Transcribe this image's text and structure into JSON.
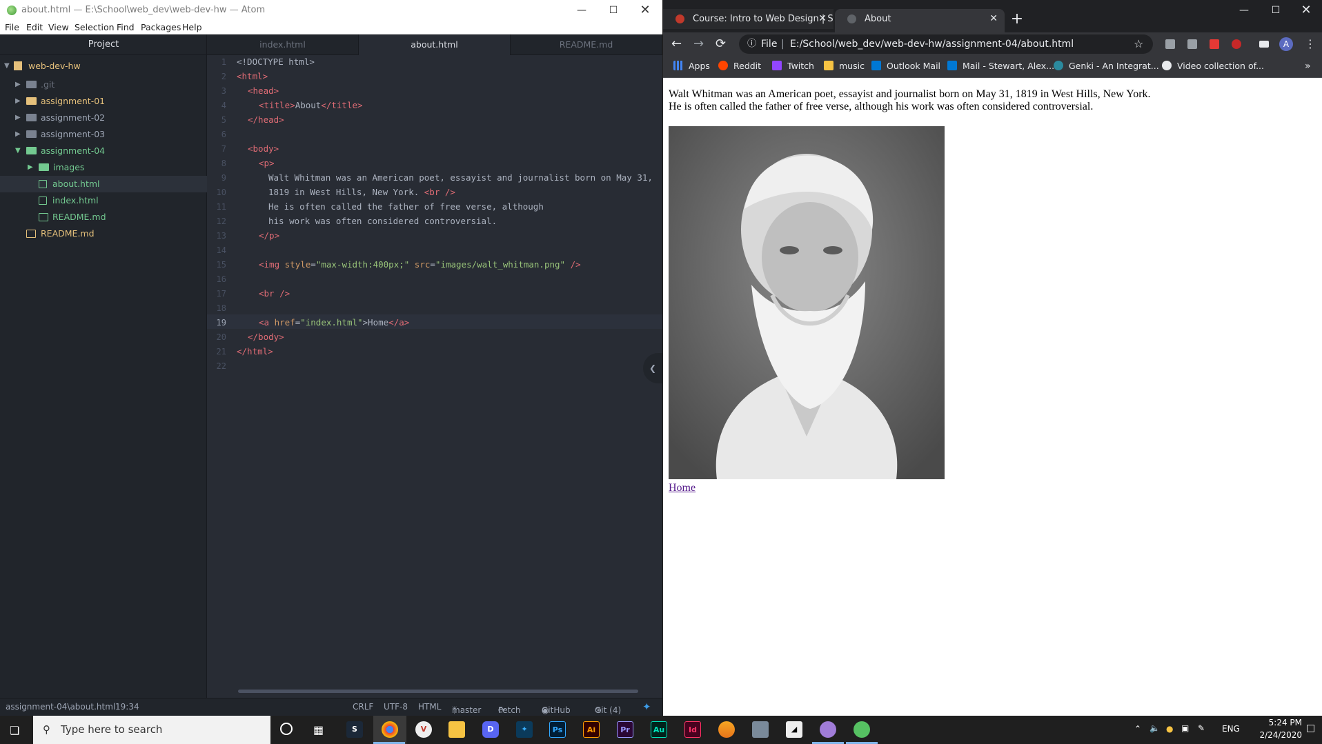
{
  "atom": {
    "title": "about.html — E:\\School\\web_dev\\web-dev-hw — Atom",
    "menu": [
      "File",
      "Edit",
      "View",
      "Selection",
      "Find",
      "Packages",
      "Help"
    ],
    "tree_header": "Project",
    "tree": [
      {
        "label": "web-dev-hw"
      },
      {
        "label": ".git"
      },
      {
        "label": "assignment-01"
      },
      {
        "label": "assignment-02"
      },
      {
        "label": "assignment-03"
      },
      {
        "label": "assignment-04"
      },
      {
        "label": "images"
      },
      {
        "label": "about.html"
      },
      {
        "label": "index.html"
      },
      {
        "label": "README.md"
      },
      {
        "label": "README.md"
      }
    ],
    "tabs": [
      "index.html",
      "about.html",
      "README.md"
    ],
    "gutter": [
      "1",
      "2",
      "3",
      "4",
      "5",
      "6",
      "7",
      "8",
      "9",
      "10",
      "11",
      "12",
      "13",
      "14",
      "15",
      "16",
      "17",
      "18",
      "19",
      "20",
      "21",
      "22"
    ],
    "status": {
      "path": "assignment-04\\about.html",
      "cursor": "19:34",
      "line_ending": "CRLF",
      "encoding": "UTF-8",
      "grammar": "HTML",
      "branch": "master",
      "fetch": "Fetch",
      "github": "GitHub",
      "git": "Git (4)"
    },
    "code": {
      "l1": "<!DOCTYPE html>",
      "l2": "<html>",
      "l3": "<head>",
      "l4a": "<title>",
      "l4b": "About",
      "l4c": "</title>",
      "l5": "</head>",
      "l7": "<body>",
      "l8": "<p>",
      "l9": "Walt Whitman was an American poet, essayist and journalist born on May 31,",
      "l10a": "1819 in West Hills, New York. ",
      "l10b": "<br />",
      "l11": "He is often called the father of free verse, although",
      "l12": "his work was often considered controversial.",
      "l13": "</p>",
      "l15a": "<img ",
      "l15b": "style",
      "l15c": "=",
      "l15d": "\"max-width:400px;\"",
      "l15e": " src",
      "l15f": "=",
      "l15g": "\"images/walt_whitman.png\"",
      "l15h": " />",
      "l17": "<br />",
      "l19a": "<a ",
      "l19b": "href",
      "l19c": "=",
      "l19d": "\"index.html\"",
      "l19e": ">Home",
      "l19f": "</a>",
      "l20": "</body>",
      "l21": "</html>"
    }
  },
  "chrome": {
    "tabs": [
      {
        "title": "Course: Intro to Web Design | Sp"
      },
      {
        "title": "About"
      }
    ],
    "address_prefix": "File",
    "url": "E:/School/web_dev/web-dev-hw/assignment-04/about.html",
    "profile_initial": "A",
    "bookmarks": [
      "Apps",
      "Reddit",
      "Twitch",
      "music",
      "Outlook Mail",
      "Mail - Stewart, Alex...",
      "Genki - An Integrat...",
      "Video collection of..."
    ],
    "page": {
      "line1": "Walt Whitman was an American poet, essayist and journalist born on May 31, 1819 in West Hills, New York.",
      "line2": "He is often called the father of free verse, although his work was often considered controversial.",
      "link": "Home"
    }
  },
  "taskbar": {
    "search_placeholder": "Type here to search",
    "apps": [
      "Ps",
      "Ai",
      "Pr",
      "Au",
      "Id"
    ],
    "lang": "ENG",
    "time": "5:24 PM",
    "date": "2/24/2020"
  }
}
